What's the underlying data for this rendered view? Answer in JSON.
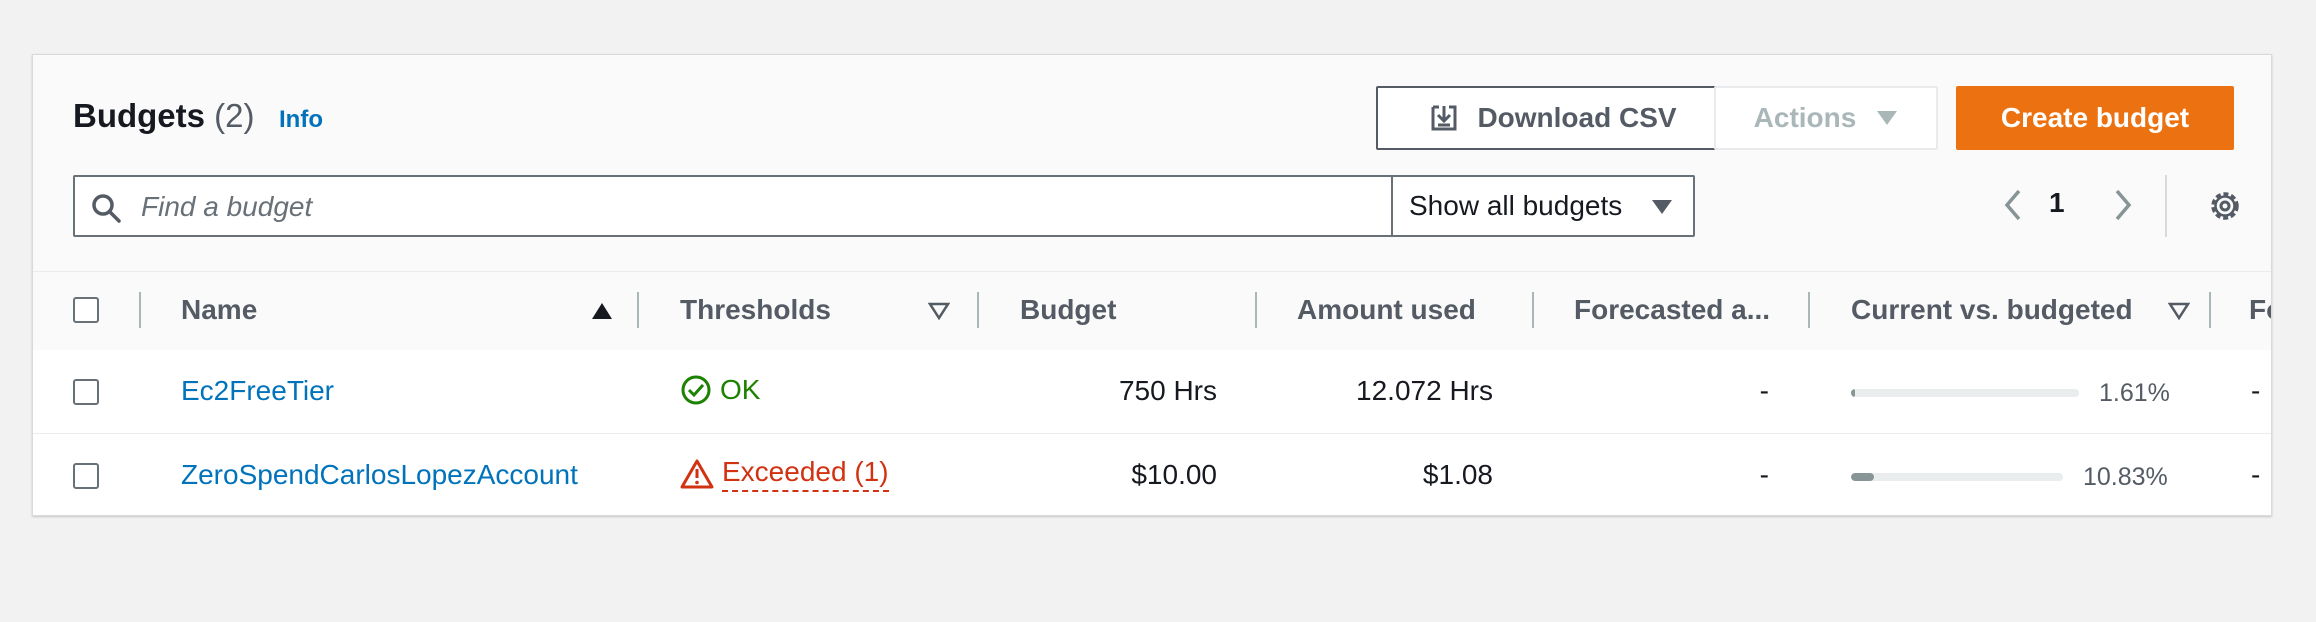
{
  "header": {
    "title": "Budgets",
    "count": "(2)",
    "info_link": "Info",
    "download_csv_label": "Download CSV",
    "actions_label": "Actions",
    "create_label": "Create budget"
  },
  "search": {
    "placeholder": "Find a budget",
    "value": ""
  },
  "filter": {
    "selected": "Show all budgets"
  },
  "pagination": {
    "current_page": "1"
  },
  "table": {
    "columns": [
      "Name",
      "Thresholds",
      "Budget",
      "Amount used",
      "Forecasted a...",
      "Current vs. budgeted",
      "Fo"
    ],
    "rows": [
      {
        "name": "Ec2FreeTier",
        "threshold": "OK",
        "threshold_status": "ok",
        "budget": "750 Hrs",
        "amount_used": "12.072 Hrs",
        "forecasted": "-",
        "current_vs_budgeted": "1.61%",
        "progress_fraction": 0.0161,
        "extra": "-"
      },
      {
        "name": "ZeroSpendCarlosLopezAccount",
        "threshold": "Exceeded (1)",
        "threshold_status": "exceeded",
        "budget": "$10.00",
        "amount_used": "$1.08",
        "forecasted": "-",
        "current_vs_budgeted": "10.83%",
        "progress_fraction": 0.1083,
        "extra": "-"
      }
    ]
  },
  "colors": {
    "primary": "#ec7211",
    "link": "#0073bb",
    "ok": "#1d8102",
    "error": "#d13212"
  },
  "icons": [
    "download-icon",
    "caret-down-icon",
    "search-icon",
    "chevron-left-icon",
    "chevron-right-icon",
    "settings-gear-icon",
    "sort-ascending-icon",
    "sort-icon",
    "check-circle-icon",
    "warning-icon"
  ]
}
